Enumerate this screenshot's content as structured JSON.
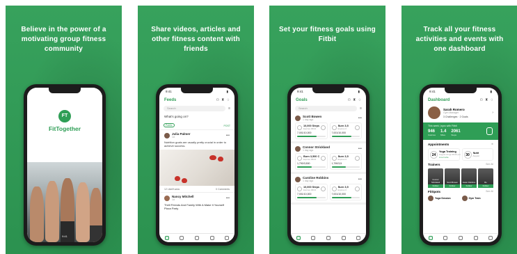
{
  "panels": [
    {
      "caption": "Believe in the power of a motivating group fitness community"
    },
    {
      "caption": "Share videos, articles and other fitness content with friends"
    },
    {
      "caption": "Set your fitness goals using Fitbit"
    },
    {
      "caption": "Track all your fitness activities and events with one dashboard"
    }
  ],
  "status_time": "9:41",
  "splash": {
    "logo": "FT",
    "brand": "FitTogether",
    "footer": "9:41"
  },
  "feeds": {
    "title": "Feeds",
    "search_placeholder": "Search",
    "compose_prompt": "What's going on?",
    "privacy": "Public",
    "post_button": "POST",
    "post1": {
      "author": "Julia Palmer",
      "sub": "1d",
      "text": "Nutrition goals are usually pretty crucial in order to achieve success.",
      "likes": "12 Like/Kudos",
      "comments": "0 Comments"
    },
    "post2": {
      "author": "Nancy Mitchell",
      "sub": "1d",
      "text": "Thrill Friends And Family With A Make It Yourself Pizza Party"
    }
  },
  "goals": {
    "title": "Goals",
    "search_placeholder": "Search",
    "cards": [
      {
        "name": "Scott Bowen",
        "sub": "1 day ago",
        "g1_title": "10,000 Steps in 1 Day",
        "g1_sub": "Expires 06/21",
        "g1_val": "7,001/10,000",
        "g1_pct": 0.7,
        "g2_title": "Burn 3,5",
        "g2_sub": "Expires 0",
        "g2_val": "7,001/10,000",
        "g2_pct": 0.7
      },
      {
        "name": "Connor Strickland",
        "sub": "1 day ago",
        "g1_title": "Burn 3,500 Calories",
        "g1_sub": "Expires 06/21",
        "g1_val": "1,790/3,500",
        "g1_pct": 0.51,
        "g2_title": "Burn 3,5",
        "g2_sub": "Expires 0",
        "g2_val": "1,790/3,5",
        "g2_pct": 0.51
      },
      {
        "name": "Caroline Robbins",
        "sub": "1 day ago",
        "g1_title": "10,000 Steps in 1 Day",
        "g1_sub": "Expires 06/21",
        "g1_val": "7,001/10,000",
        "g1_pct": 0.7,
        "g2_title": "Burn 3,5",
        "g2_sub": "Expires 0",
        "g2_val": "7,001/10,000",
        "g2_pct": 0.7
      }
    ]
  },
  "dashboard": {
    "title": "Dashboard",
    "name": "Sarah Romero",
    "role": "Gym Manager",
    "challenges": "3 Challenges",
    "goals": "2 Goals",
    "week_title": "This week | sync with Fitbit",
    "stats": [
      {
        "value": "946",
        "label": "Calories"
      },
      {
        "value": "1.4",
        "label": "Miles"
      },
      {
        "value": "2061",
        "label": "Steps"
      }
    ],
    "appointments_label": "Appointments",
    "appointments": [
      {
        "day": "24",
        "title": "Yoga Training",
        "sub": "August 24 @ 06:00 pm",
        "link": "Live Invite"
      },
      {
        "day": "30",
        "title": "Nutri",
        "sub": "August",
        "link": ""
      }
    ],
    "trainers_label": "Trainers",
    "see_all": "See All",
    "trainers": [
      {
        "name": "Connor Strickland",
        "follow": "Follow"
      },
      {
        "name": "Scott Bowen",
        "follow": "Follow"
      },
      {
        "name": "Jason Robbins",
        "follow": "Follow"
      },
      {
        "name": "Bo",
        "follow": "Follow"
      }
    ],
    "fitspots_label": "FitSpots",
    "spots": [
      {
        "name": "Yoga Session"
      },
      {
        "name": "Gym Train"
      }
    ]
  }
}
